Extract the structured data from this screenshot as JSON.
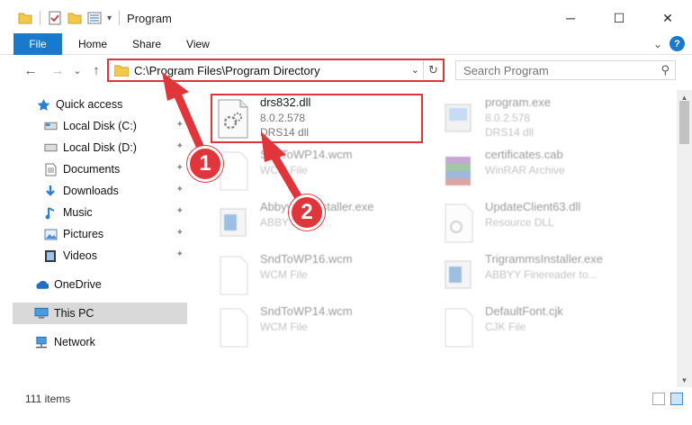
{
  "window": {
    "title": "Program",
    "minimize": "─",
    "maximize": "☐",
    "close": "✕"
  },
  "ribbon": {
    "tabs": [
      "File",
      "Home",
      "Share",
      "View"
    ],
    "collapse_glyph": "⌄",
    "help_glyph": "?"
  },
  "nav": {
    "back": "←",
    "forward": "→",
    "recent": "⌄",
    "up": "↑"
  },
  "address": {
    "path": "C:\\Program Files\\Program Directory",
    "dropdown_glyph": "⌄",
    "refresh_glyph": "↻"
  },
  "search": {
    "placeholder": "Search Program",
    "icon_glyph": "⚲"
  },
  "sidebar": {
    "pin_glyph": "✦",
    "items": [
      {
        "label": "Quick access",
        "icon": "star-icon"
      },
      {
        "label": "Local Disk (C:)",
        "icon": "drive-icon",
        "pinned": true
      },
      {
        "label": "Local Disk (D:)",
        "icon": "drive-icon",
        "pinned": true
      },
      {
        "label": "Documents",
        "icon": "documents-icon",
        "pinned": true
      },
      {
        "label": "Downloads",
        "icon": "downloads-icon",
        "pinned": true
      },
      {
        "label": "Music",
        "icon": "music-icon",
        "pinned": true
      },
      {
        "label": "Pictures",
        "icon": "pictures-icon",
        "pinned": true
      },
      {
        "label": "Videos",
        "icon": "videos-icon",
        "pinned": true
      },
      {
        "label": "OneDrive",
        "icon": "onedrive-icon"
      },
      {
        "label": "This PC",
        "icon": "pc-icon",
        "selected": true
      },
      {
        "label": "Network",
        "icon": "network-icon"
      }
    ]
  },
  "files": [
    {
      "name": "drs832.dll",
      "line2": "8.0.2.578",
      "line3": "DRS14 dll",
      "icon": "dll-file-icon",
      "highlighted": true
    },
    {
      "name": "program.exe",
      "line2": "8.0.2.578",
      "line3": "DRS14 dll",
      "icon": "exe-file-icon"
    },
    {
      "name": "SndToWP14.wcm",
      "line2": "WCM File",
      "line3": "",
      "icon": "generic-file-icon"
    },
    {
      "name": "certificates.cab",
      "line2": "WinRAR Archive",
      "line3": "",
      "icon": "winrar-icon"
    },
    {
      "name": "AbbyyOcrInstaller.exe",
      "line2": "ABBYY Yand...",
      "line3": "",
      "icon": "installer-icon"
    },
    {
      "name": "UpdateClient63.dll",
      "line2": "Resource DLL",
      "line3": "",
      "icon": "dll-file-icon"
    },
    {
      "name": "SndToWP16.wcm",
      "line2": "WCM File",
      "line3": "",
      "icon": "generic-file-icon"
    },
    {
      "name": "TrigrammsInstaller.exe",
      "line2": "ABBYY Finereader to...",
      "line3": "",
      "icon": "installer-icon"
    },
    {
      "name": "SndToWP14.wcm",
      "line2": "WCM File",
      "line3": "",
      "icon": "generic-file-icon"
    },
    {
      "name": "DefaultFont.cjk",
      "line2": "CJK File",
      "line3": "",
      "icon": "generic-file-icon"
    }
  ],
  "status": {
    "count": "111 items"
  },
  "annotations": {
    "step1": "1",
    "step2": "2",
    "color": "#e0353b"
  }
}
